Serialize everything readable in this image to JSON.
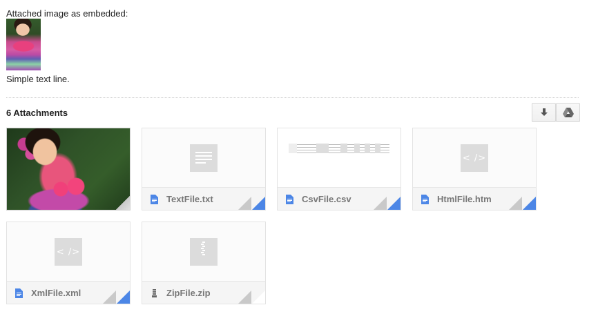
{
  "message": {
    "embedded_label": "Attached image as embedded:",
    "simple_text": "Simple text line."
  },
  "attachments": {
    "count_label": "6 Attachments",
    "toolbar": {
      "download_icon": "download-icon",
      "drive_icon": "google-drive-icon"
    },
    "items": [
      {
        "name": "",
        "type": "image"
      },
      {
        "name": "TextFile.txt",
        "type": "text",
        "icon": "document-icon"
      },
      {
        "name": "CsvFile.csv",
        "type": "csv",
        "icon": "document-icon"
      },
      {
        "name": "HtmlFile.htm",
        "type": "html",
        "icon": "document-icon",
        "glyph": "< />"
      },
      {
        "name": "XmlFile.xml",
        "type": "xml",
        "icon": "document-icon",
        "glyph": "< />"
      },
      {
        "name": "ZipFile.zip",
        "type": "zip",
        "icon": "zip-icon"
      }
    ]
  },
  "colors": {
    "doc_icon_blue": "#4c86e6",
    "label_gray": "#777777"
  }
}
